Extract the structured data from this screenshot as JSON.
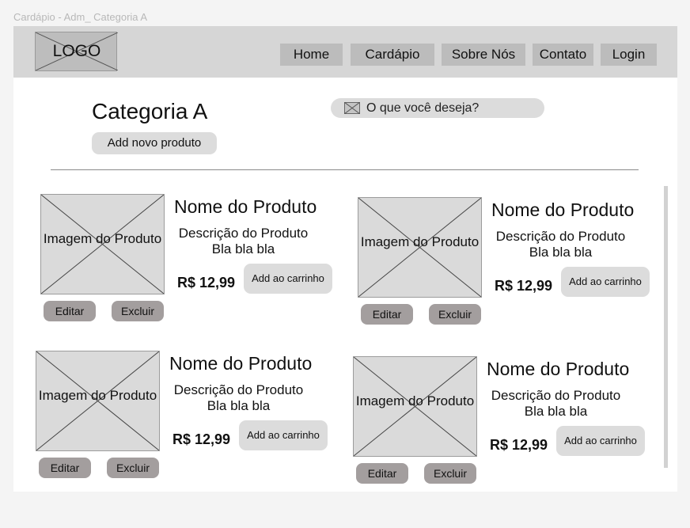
{
  "frame_label": "Cardápio - Adm_ Categoria A",
  "header": {
    "logo": "LOGO",
    "nav": [
      "Home",
      "Cardápio",
      "Sobre Nós",
      "Contato",
      "Login"
    ]
  },
  "page": {
    "title": "Categoria A",
    "add_button": "Add novo produto",
    "search_placeholder": "O que você deseja?"
  },
  "products": [
    {
      "image_label": "Imagem do Produto",
      "name": "Nome do Produto",
      "description": "Descrição do Produto Bla bla bla",
      "price": "R$ 12,99",
      "cart_label": "Add ao carrinho",
      "edit_label": "Editar",
      "delete_label": "Excluir"
    },
    {
      "image_label": "Imagem do Produto",
      "name": "Nome do Produto",
      "description": "Descrição do Produto Bla bla bla",
      "price": "R$ 12,99",
      "cart_label": "Add ao carrinho",
      "edit_label": "Editar",
      "delete_label": "Excluir"
    },
    {
      "image_label": "Imagem do Produto",
      "name": "Nome do Produto",
      "description": "Descrição do Produto Bla bla bla",
      "price": "R$ 12,99",
      "cart_label": "Add ao carrinho",
      "edit_label": "Editar",
      "delete_label": "Excluir"
    },
    {
      "image_label": "Imagem do Produto",
      "name": "Nome do Produto",
      "description": "Descrição do Produto Bla bla bla",
      "price": "R$ 12,99",
      "cart_label": "Add ao carrinho",
      "edit_label": "Editar",
      "delete_label": "Excluir"
    }
  ]
}
